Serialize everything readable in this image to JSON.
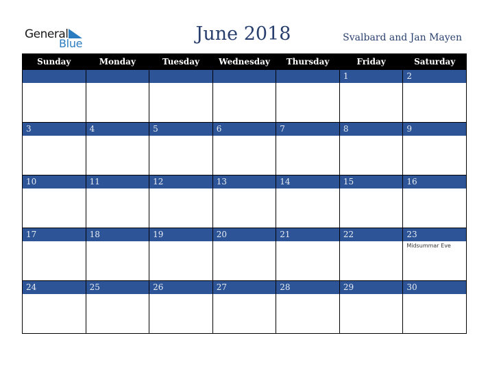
{
  "logo": {
    "line1": "General",
    "line2": "Blue"
  },
  "header": {
    "title": "June 2018",
    "region": "Svalbard and Jan Mayen"
  },
  "weekdays": [
    "Sunday",
    "Monday",
    "Tuesday",
    "Wednesday",
    "Thursday",
    "Friday",
    "Saturday"
  ],
  "weeks": [
    [
      "",
      "",
      "",
      "",
      "",
      "1",
      "2"
    ],
    [
      "3",
      "4",
      "5",
      "6",
      "7",
      "8",
      "9"
    ],
    [
      "10",
      "11",
      "12",
      "13",
      "14",
      "15",
      "16"
    ],
    [
      "17",
      "18",
      "19",
      "20",
      "21",
      "22",
      "23"
    ],
    [
      "24",
      "25",
      "26",
      "27",
      "28",
      "29",
      "30"
    ]
  ],
  "events": {
    "23": "Midsummar Eve"
  },
  "colors": {
    "band": "#2c5496",
    "title": "#283f6e",
    "header_bg": "#000000",
    "logo_blue": "#2a7bc0"
  }
}
